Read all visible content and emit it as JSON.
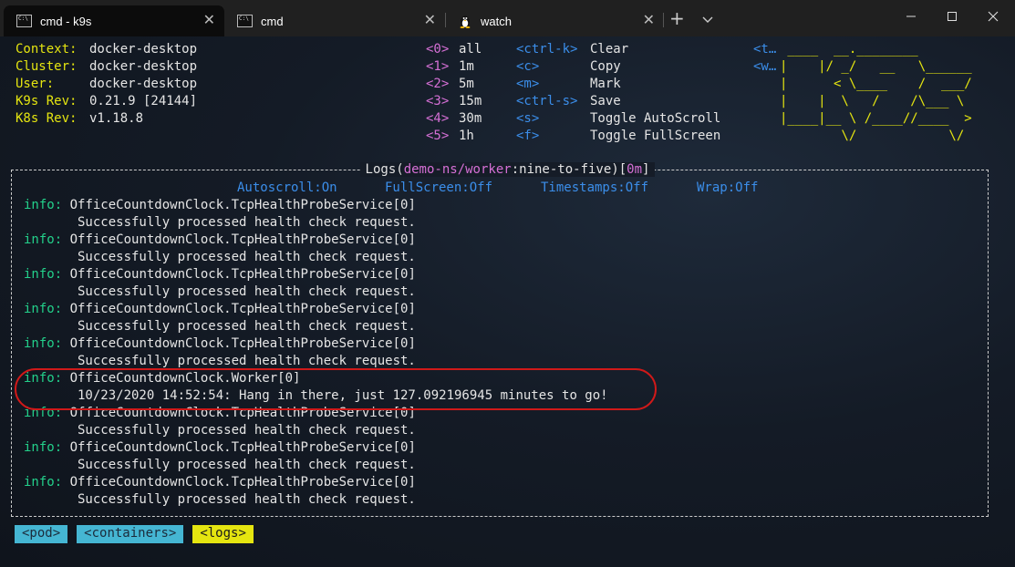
{
  "tabs": [
    {
      "label": "cmd - k9s",
      "active": true,
      "icon": "cmd-icon"
    },
    {
      "label": "cmd",
      "active": false,
      "icon": "cmd-icon"
    },
    {
      "label": "watch",
      "active": false,
      "icon": "tux-icon"
    }
  ],
  "window_controls": {
    "new_tab": "+",
    "close_glyph": "✕"
  },
  "header": {
    "info": [
      {
        "key": "Context:",
        "value": "docker-desktop"
      },
      {
        "key": "Cluster:",
        "value": "docker-desktop"
      },
      {
        "key": "User:",
        "value": "docker-desktop"
      },
      {
        "key": "K9s Rev:",
        "value": "0.21.9 [24144]"
      },
      {
        "key": "K8s Rev:",
        "value": "v1.18.8"
      }
    ],
    "time_shortcuts": [
      {
        "key": "<0>",
        "label": "all"
      },
      {
        "key": "<1>",
        "label": "1m"
      },
      {
        "key": "<2>",
        "label": "5m"
      },
      {
        "key": "<3>",
        "label": "15m"
      },
      {
        "key": "<4>",
        "label": "30m"
      },
      {
        "key": "<5>",
        "label": "1h"
      }
    ],
    "action_shortcuts": [
      {
        "key": "<ctrl-k>",
        "label": "Clear"
      },
      {
        "key": "<c>",
        "label": "Copy"
      },
      {
        "key": "<m>",
        "label": "Mark"
      },
      {
        "key": "<ctrl-s>",
        "label": "Save"
      },
      {
        "key": "<s>",
        "label": "Toggle AutoScroll"
      },
      {
        "key": "<f>",
        "label": "Toggle FullScreen"
      }
    ],
    "truncated_shortcuts": [
      "<t…",
      "<w…"
    ],
    "logo_lines": [
      " ____  __.________",
      "|    |/ _/   __   \\______",
      "|      < \\____    /  ___/",
      "|    |  \\   /    /\\___ \\",
      "|____|__ \\ /____//____  >",
      "        \\/            \\/"
    ]
  },
  "logs": {
    "title_prefix": "Logs(",
    "title_ns": "demo-ns/worker",
    "title_sep": ":",
    "title_container": "nine-to-five",
    "title_bracket_open": ")[",
    "title_since": "0m",
    "title_bracket_close": "]",
    "toggles": [
      {
        "label": "Autoscroll:On"
      },
      {
        "label": "FullScreen:Off"
      },
      {
        "label": "Timestamps:Off"
      },
      {
        "label": "Wrap:Off"
      }
    ],
    "lines": [
      {
        "level": "info:",
        "text": " OfficeCountdownClock.TcpHealthProbeService[0]"
      },
      {
        "level": "",
        "text": "       Successfully processed health check request."
      },
      {
        "level": "info:",
        "text": " OfficeCountdownClock.TcpHealthProbeService[0]"
      },
      {
        "level": "",
        "text": "       Successfully processed health check request."
      },
      {
        "level": "info:",
        "text": " OfficeCountdownClock.TcpHealthProbeService[0]"
      },
      {
        "level": "",
        "text": "       Successfully processed health check request."
      },
      {
        "level": "info:",
        "text": " OfficeCountdownClock.TcpHealthProbeService[0]"
      },
      {
        "level": "",
        "text": "       Successfully processed health check request."
      },
      {
        "level": "info:",
        "text": " OfficeCountdownClock.TcpHealthProbeService[0]"
      },
      {
        "level": "",
        "text": "       Successfully processed health check request."
      },
      {
        "level": "info:",
        "text": " OfficeCountdownClock.Worker[0]"
      },
      {
        "level": "",
        "text": "       10/23/2020 14:52:54: Hang in there, just 127.092196945 minutes to go!"
      },
      {
        "level": "info:",
        "text": " OfficeCountdownClock.TcpHealthProbeService[0]"
      },
      {
        "level": "",
        "text": "       Successfully processed health check request."
      },
      {
        "level": "info:",
        "text": " OfficeCountdownClock.TcpHealthProbeService[0]"
      },
      {
        "level": "",
        "text": "       Successfully processed health check request."
      },
      {
        "level": "info:",
        "text": " OfficeCountdownClock.TcpHealthProbeService[0]"
      },
      {
        "level": "",
        "text": "       Successfully processed health check request."
      }
    ]
  },
  "breadcrumbs": [
    {
      "label": "<pod>",
      "color": "#45b6d3"
    },
    {
      "label": "<containers>",
      "color": "#45b6d3"
    },
    {
      "label": "<logs>",
      "color": "#e5e510"
    }
  ]
}
